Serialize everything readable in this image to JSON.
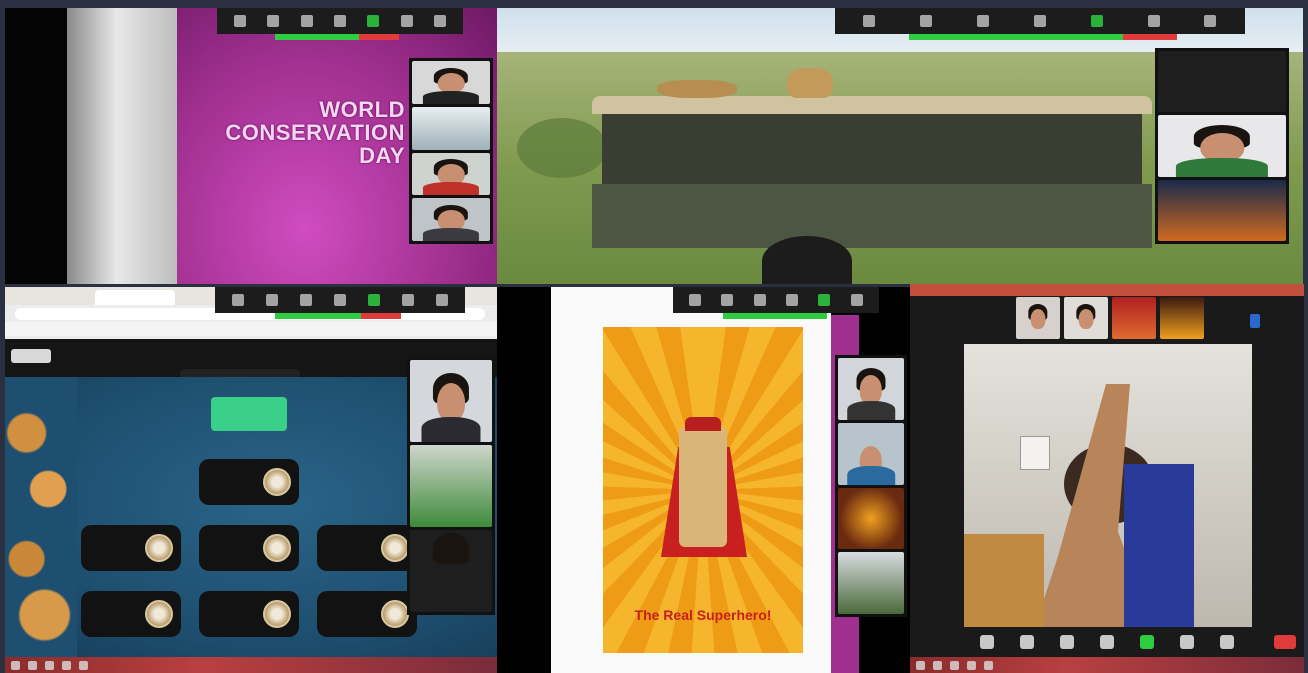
{
  "collage": {
    "panel1": {
      "slide_title_line1": "WORLD",
      "slide_title_line2": "CONSERVATION DAY"
    },
    "panel4": {
      "poster_caption": "The Real Superhero!"
    }
  },
  "colors": {
    "background": "#2b3040",
    "zoom_toolbar": "#1c1c1c",
    "share_active": "#2ecc40",
    "stop_share": "#e03a3a",
    "slide_purple": "#a0308f",
    "poster_orange": "#f2a81e",
    "game_blue": "#1e4f70"
  },
  "icons": {
    "toolbar": [
      "mic-icon",
      "video-icon",
      "participants-icon",
      "chat-icon",
      "share-screen-icon",
      "record-icon",
      "reactions-icon"
    ],
    "taskbar": [
      "windows-start-icon",
      "search-icon",
      "browser-icon",
      "folder-icon",
      "zoom-app-icon"
    ]
  }
}
